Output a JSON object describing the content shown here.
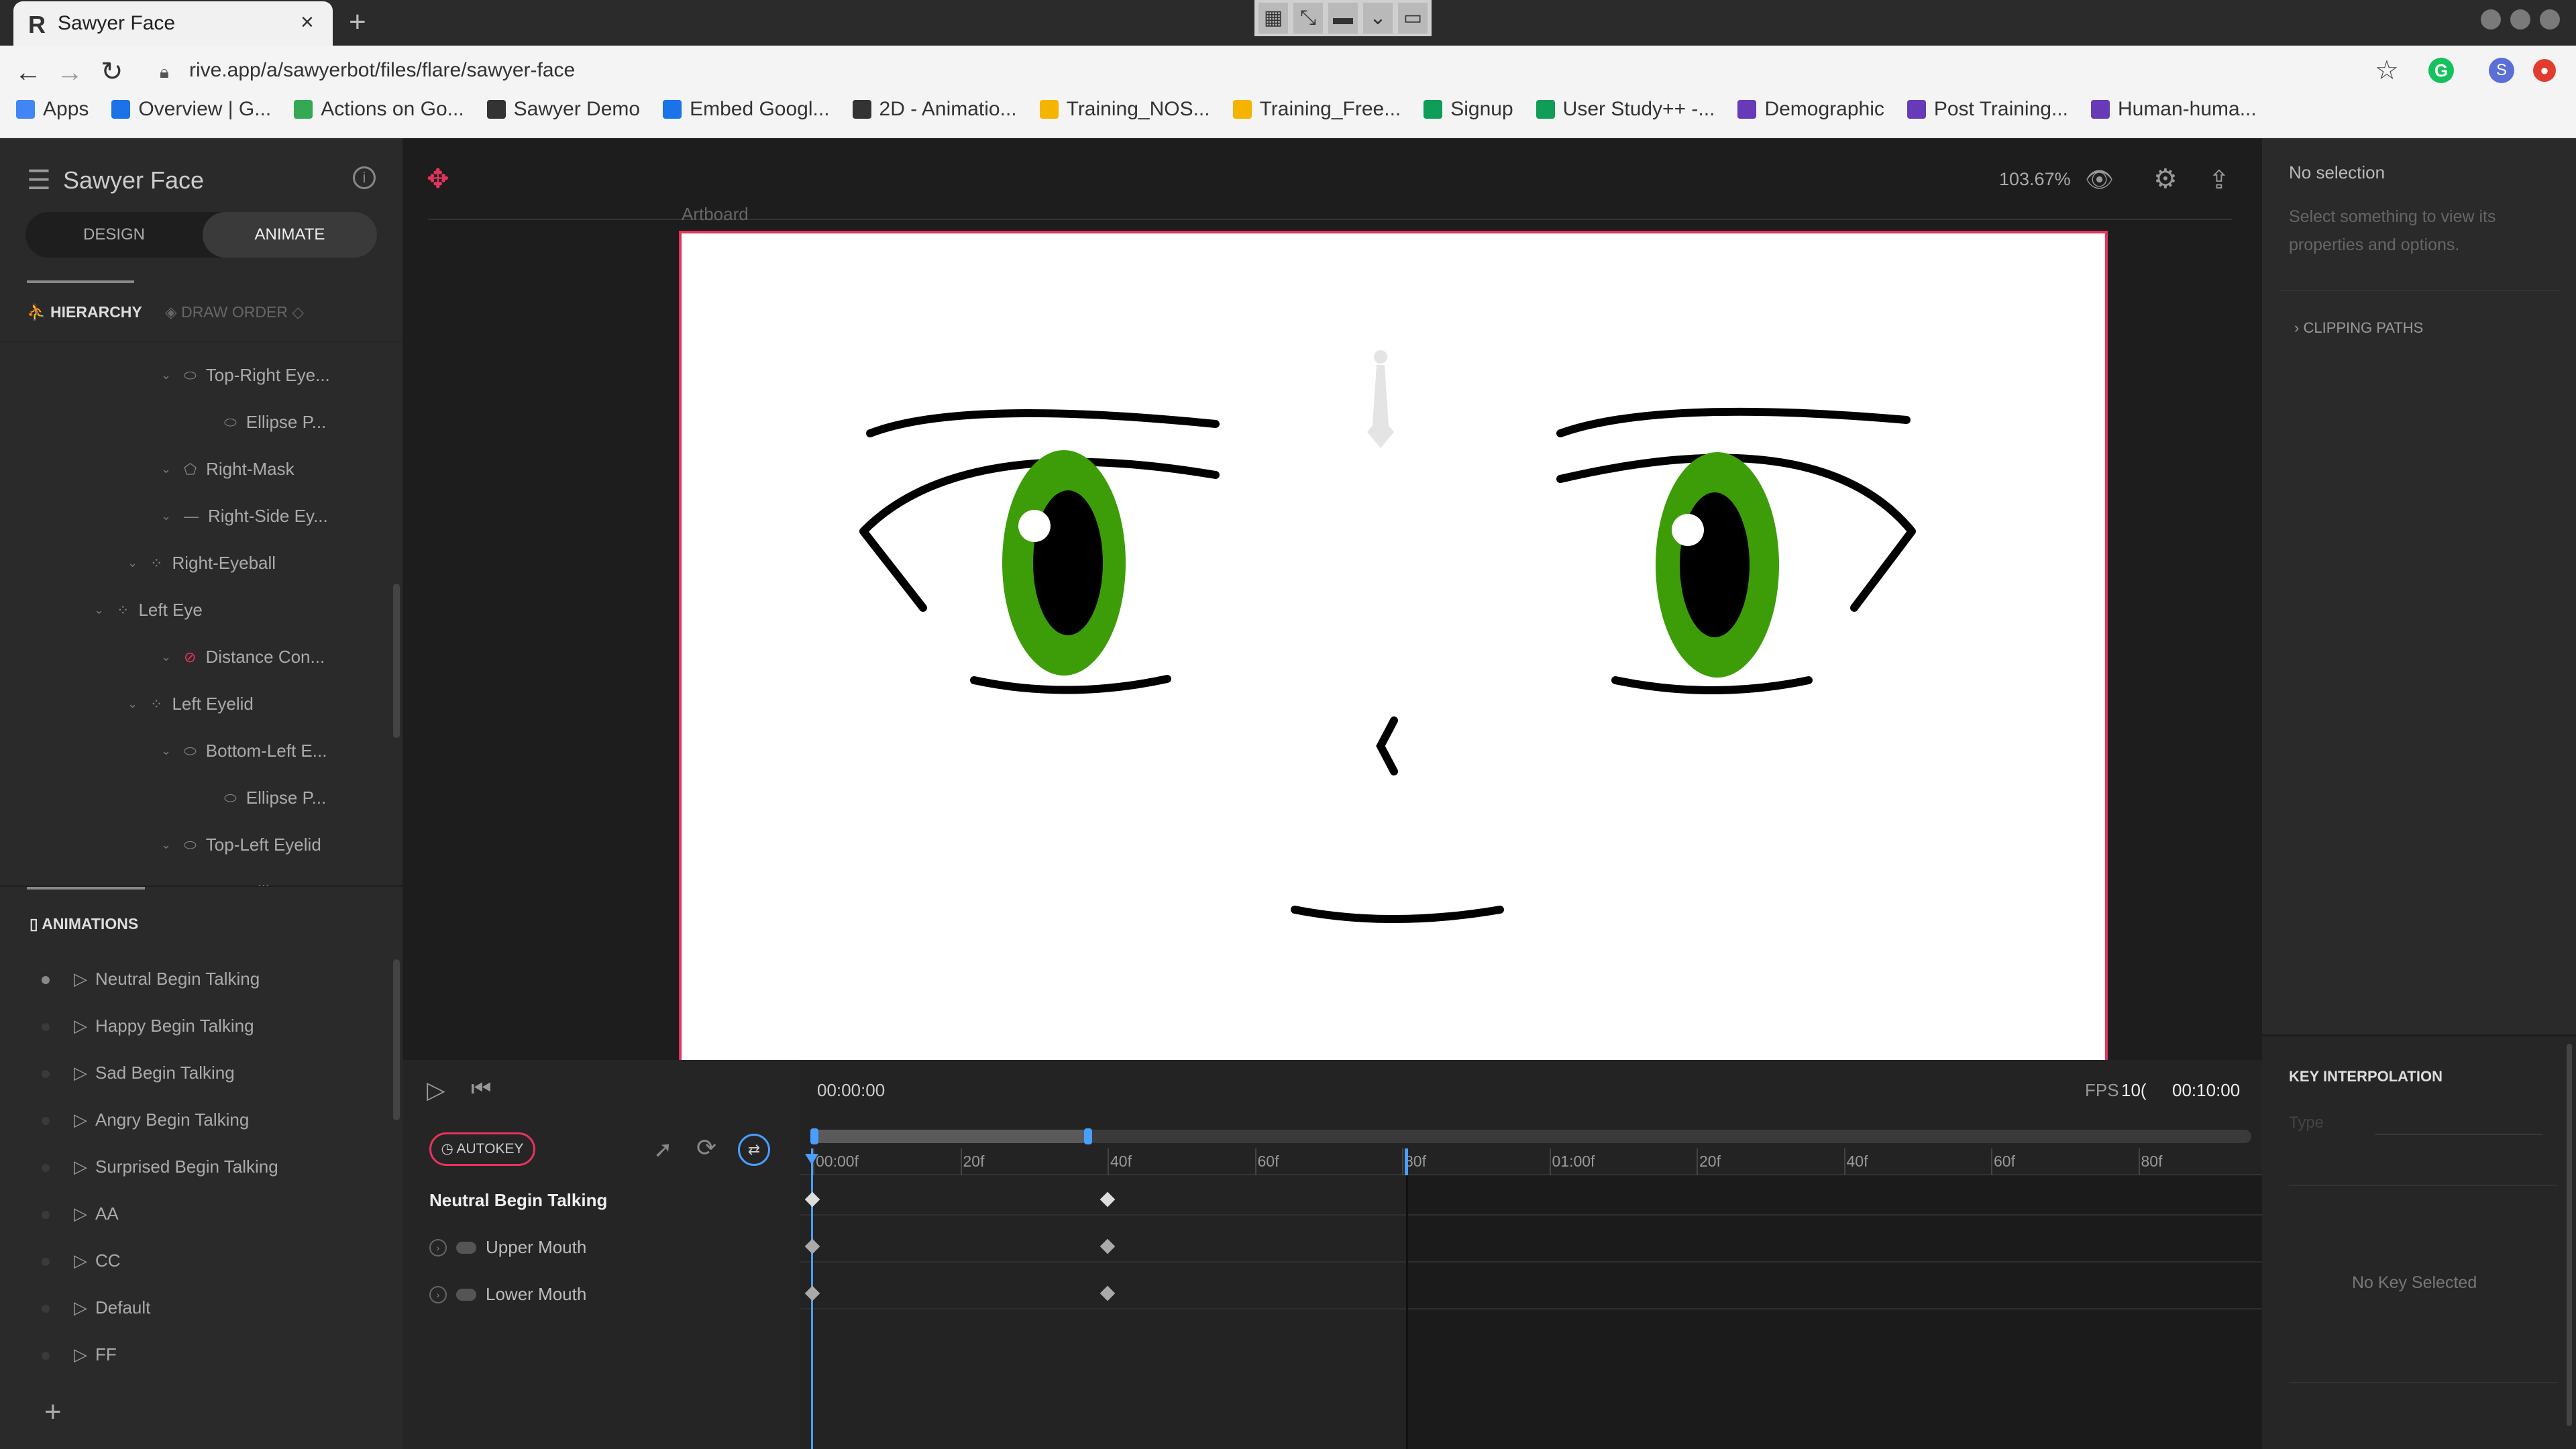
{
  "browser": {
    "tab_title": "Sawyer Face",
    "tab_close": "×",
    "new_tab": "+",
    "url": "rive.app/a/sawyerbot/files/flare/sawyer-face",
    "bookmarks": [
      {
        "label": "Apps",
        "color": "#4285f4"
      },
      {
        "label": "Overview | G...",
        "color": "#1a73e8"
      },
      {
        "label": "Actions on Go...",
        "color": "#34a853"
      },
      {
        "label": "Sawyer Demo",
        "color": "#333333"
      },
      {
        "label": "Embed Googl...",
        "color": "#1a73e8"
      },
      {
        "label": "2D - Animatio...",
        "color": "#333333"
      },
      {
        "label": "Training_NOS...",
        "color": "#f4b400"
      },
      {
        "label": "Training_Free...",
        "color": "#f4b400"
      },
      {
        "label": "Signup",
        "color": "#0f9d58"
      },
      {
        "label": "User Study++ -...",
        "color": "#0f9d58"
      },
      {
        "label": "Demographic",
        "color": "#673ab7"
      },
      {
        "label": "Post Training...",
        "color": "#673ab7"
      },
      {
        "label": "Human-huma...",
        "color": "#673ab7"
      }
    ],
    "avatar_letter": "S"
  },
  "editor": {
    "file_title": "Sawyer Face",
    "modes": {
      "design": "DESIGN",
      "animate": "ANIMATE"
    },
    "panel_tabs": {
      "hierarchy": "HIERARCHY",
      "draw_order": "DRAW ORDER"
    },
    "hierarchy": [
      {
        "label": "Top-Right Eye...",
        "icon": "ellipse-icon"
      },
      {
        "label": "Ellipse P...",
        "icon": "ellipse-path-icon"
      },
      {
        "label": "Right-Mask",
        "icon": "shape-icon"
      },
      {
        "label": "Right-Side Ey...",
        "icon": "line-icon"
      },
      {
        "label": "Right-Eyeball",
        "icon": "group-icon"
      },
      {
        "label": "Left Eye",
        "icon": "group-icon"
      },
      {
        "label": "Distance Con...",
        "icon": "constraint-icon"
      },
      {
        "label": "Left Eyelid",
        "icon": "group-icon"
      },
      {
        "label": "Bottom-Left E...",
        "icon": "ellipse-icon"
      },
      {
        "label": "Ellipse P...",
        "icon": "ellipse-path-icon"
      },
      {
        "label": "Top-Left Eyelid",
        "icon": "ellipse-icon"
      },
      {
        "label": "Ellipse P...",
        "icon": "ellipse-path-icon"
      }
    ],
    "animations_header": "ANIMATIONS",
    "animations": [
      "Neutral Begin Talking",
      "Happy Begin Talking",
      "Sad Begin Talking",
      "Angry Begin Talking",
      "Surprised Begin Talking",
      "AA",
      "CC",
      "Default",
      "FF"
    ],
    "add_label": "+"
  },
  "stage": {
    "artboard_label": "Artboard",
    "zoom": "103.67%",
    "accent_color": "#e4345e",
    "eye_color": "#3c9d08"
  },
  "inspector": {
    "no_selection": "No selection",
    "no_selection_desc": "Select something to view its properties and options.",
    "clipping_paths": "CLIPPING PATHS",
    "key_interpolation": "KEY INTERPOLATION",
    "type_label": "Type",
    "no_key": "No Key Selected"
  },
  "timeline": {
    "timecode": "00:00:00",
    "fps_label": "FPS",
    "fps_value": "10(",
    "duration": "00:10:00",
    "autokey": "AUTOKEY",
    "animation_title": "Neutral Begin Talking",
    "tracks": [
      "Upper Mouth",
      "Lower Mouth"
    ],
    "ruler": [
      "00:00f",
      "20f",
      "40f",
      "60f",
      "80f",
      "01:00f",
      "20f",
      "40f",
      "60f",
      "80f"
    ]
  }
}
